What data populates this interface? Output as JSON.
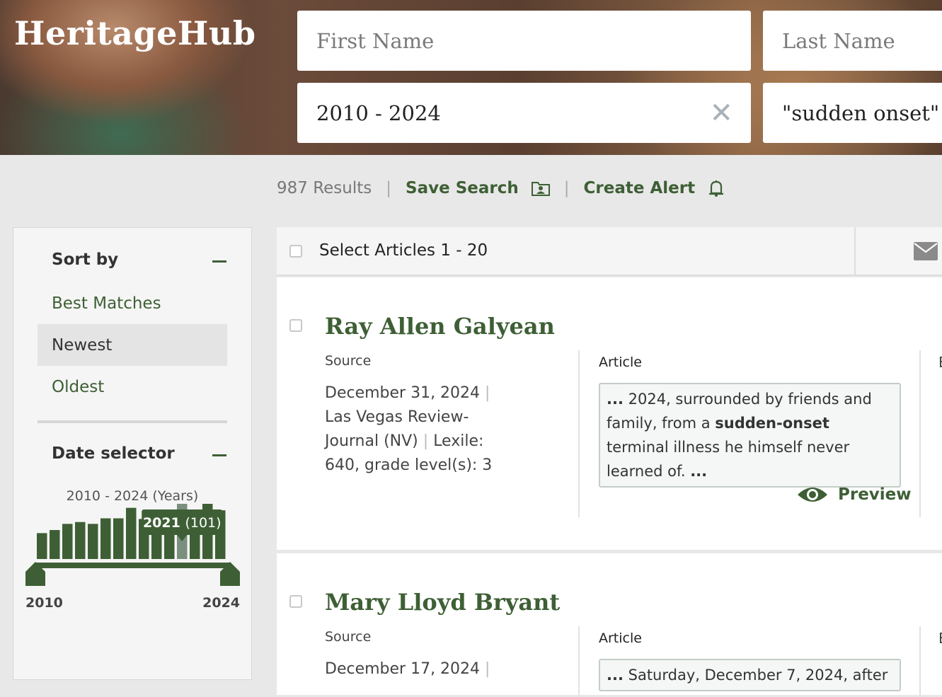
{
  "brand": {
    "name": "HeritageHub"
  },
  "search": {
    "first_name_placeholder": "First Name",
    "last_name_placeholder": "Last Name",
    "date_range_value": "2010 - 2024",
    "clear_symbol": "✕",
    "keyword_value": "\"sudden onset\""
  },
  "results": {
    "count_text": "987 Results",
    "separator": "|",
    "save_search_label": "Save Search",
    "create_alert_label": "Create Alert"
  },
  "sidebar": {
    "sort_heading": "Sort by",
    "sort_options": [
      "Best Matches",
      "Newest",
      "Oldest"
    ],
    "sort_active": "Newest",
    "date_heading": "Date selector",
    "date_range_label": "2010 - 2024 (Years)",
    "tooltip_year": "2021",
    "tooltip_count": "(101)",
    "range_start": "2010",
    "range_end": "2024"
  },
  "chart_data": {
    "type": "bar",
    "categories": [
      "2010",
      "2011",
      "2012",
      "2013",
      "2014",
      "2015",
      "2016",
      "2017",
      "2018",
      "2019",
      "2020",
      "2021",
      "2022",
      "2023",
      "2024"
    ],
    "values": [
      42,
      47,
      57,
      60,
      57,
      66,
      66,
      83,
      65,
      59,
      65,
      101,
      78,
      101,
      79
    ],
    "highlight": "2021",
    "bar_color": "#3e5f35",
    "highlight_color": "#7a8f7d"
  },
  "list": {
    "select_label": "Select Articles 1 - 20",
    "icons": {
      "email": "envelope-icon",
      "save": "folder-person-icon",
      "alert": "bell-icon",
      "preview": "eye-icon"
    },
    "articles": [
      {
        "title": "Ray Allen Galyean",
        "source_label": "Source",
        "date": "December 31, 2024",
        "publication": "Las Vegas Review-Journal (NV)",
        "lexile": "Lexile: 640, grade level(s): 3",
        "article_label": "Article",
        "snippet_before": "2024, surrounded by friends and family, from a",
        "snippet_bold": "sudden-onset",
        "snippet_after": "terminal illness he himself never learned of.",
        "ellipsis": "...",
        "preview_label": "Preview",
        "extra_col_initial": "E"
      },
      {
        "title": "Mary Lloyd Bryant",
        "source_label": "Source",
        "date": "December 17, 2024",
        "article_label": "Article",
        "snippet_text": "Saturday, December 7, 2024, after",
        "extra_col_initial": "E"
      }
    ]
  }
}
